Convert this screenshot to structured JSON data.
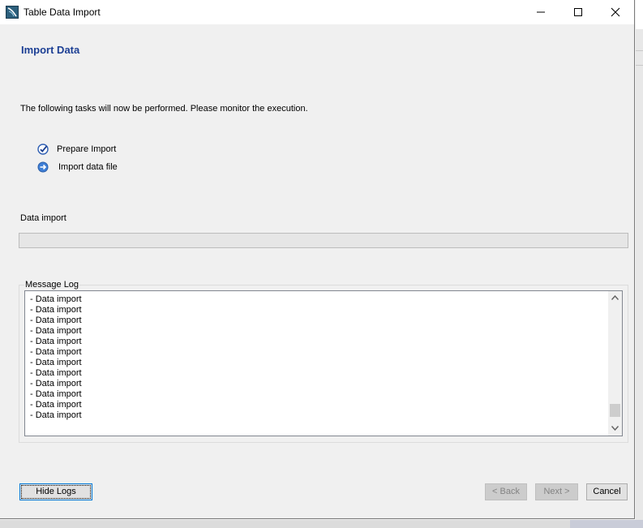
{
  "window": {
    "title": "Table Data Import"
  },
  "page": {
    "heading": "Import Data",
    "description": "The following tasks will now be performed. Please monitor the execution."
  },
  "tasks": [
    {
      "label": "Prepare Import",
      "status": "done",
      "icon": "check-icon"
    },
    {
      "label": "Import data file",
      "status": "in-progress",
      "icon": "arrow-right-icon"
    }
  ],
  "progress": {
    "label": "Data import",
    "fraction": 0
  },
  "message_log": {
    "label": "Message Log",
    "lines": [
      "- Data import",
      "- Data import",
      "- Data import",
      "- Data import",
      "- Data import",
      "- Data import",
      "- Data import",
      "- Data import",
      "- Data import",
      "- Data import",
      "- Data import",
      "- Data import"
    ],
    "scroll_position": 0.95
  },
  "buttons": {
    "hide_logs": "Hide Logs",
    "back": "< Back",
    "next": "Next >",
    "cancel": "Cancel"
  },
  "colors": {
    "heading": "#1c3f94",
    "focus_border": "#0078d7"
  }
}
